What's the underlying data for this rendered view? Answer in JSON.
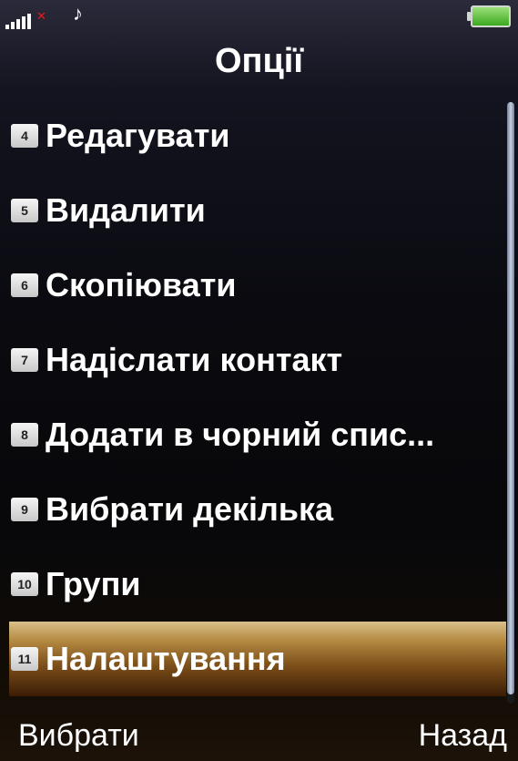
{
  "status": {
    "signal_icon": "signal-bars-icon",
    "nosim_icon": "no-sim-icon",
    "music_icon": "music-note-icon",
    "battery_icon": "battery-icon",
    "battery_color": "#3ca81f"
  },
  "title": "Опції",
  "menu": {
    "items": [
      {
        "key": "4",
        "label": "Редагувати"
      },
      {
        "key": "5",
        "label": "Видалити"
      },
      {
        "key": "6",
        "label": "Скопіювати"
      },
      {
        "key": "7",
        "label": "Надіслати контакт"
      },
      {
        "key": "8",
        "label": "Додати в чорний спис..."
      },
      {
        "key": "9",
        "label": "Вибрати декілька"
      },
      {
        "key": "10",
        "label": "Групи"
      },
      {
        "key": "11",
        "label": "Налаштування"
      }
    ],
    "selected_index": 7,
    "highlight_color": "#b58a42"
  },
  "softkeys": {
    "left": "Вибрати",
    "right": "Назад"
  }
}
